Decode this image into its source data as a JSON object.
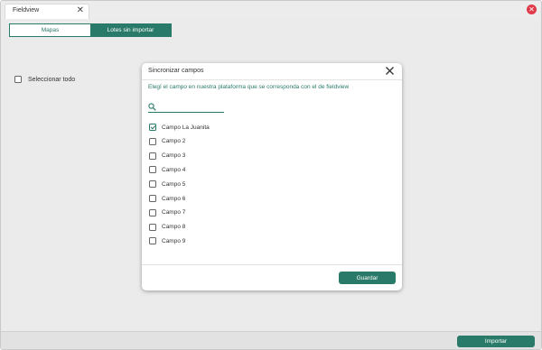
{
  "window": {
    "tab_title": "Fieldview",
    "tab_close_icon": "close-icon",
    "close_icon": "close-circle-icon"
  },
  "tabs": {
    "mapas": "Mapas",
    "lotes": "Lotes sin importar",
    "active": "lotes"
  },
  "select_all_label": "Seleccionar todo",
  "footer": {
    "import_label": "Importar"
  },
  "modal": {
    "title": "Sincronizar campos",
    "subtitle": "Elegí el campo en nuestra plataforma que se corresponda con el de fieldview",
    "search_placeholder": "",
    "fields": [
      {
        "label": "Campo La Juanita",
        "checked": true
      },
      {
        "label": "Campo 2",
        "checked": false
      },
      {
        "label": "Campo 3",
        "checked": false
      },
      {
        "label": "Campo 4",
        "checked": false
      },
      {
        "label": "Campo 5",
        "checked": false
      },
      {
        "label": "Campo 6",
        "checked": false
      },
      {
        "label": "Campo 7",
        "checked": false
      },
      {
        "label": "Campo 8",
        "checked": false
      },
      {
        "label": "Campo 9",
        "checked": false
      }
    ],
    "save_label": "Guardar"
  },
  "colors": {
    "accent": "#2a7a6a",
    "close_red": "#e0394a"
  }
}
